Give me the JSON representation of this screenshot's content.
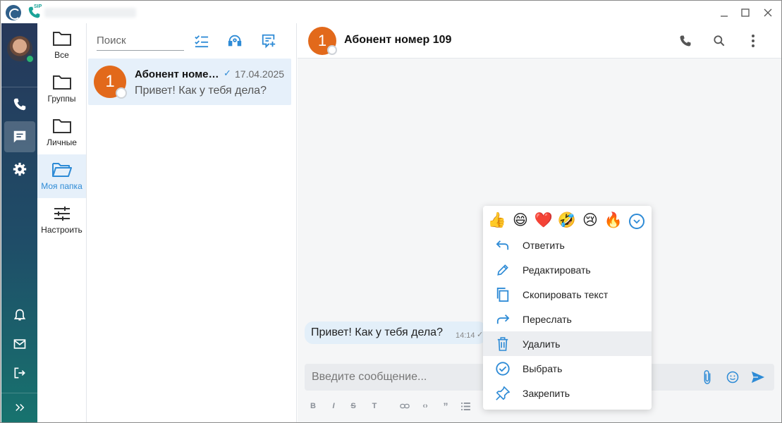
{
  "colors": {
    "accent": "#2e8bd6",
    "avatar_orange": "#e2691b",
    "online_green": "#2bb673"
  },
  "sidebar": {
    "items": [
      {
        "icon": "phone-icon"
      },
      {
        "icon": "chat-icon",
        "active": true
      },
      {
        "icon": "gear-icon"
      },
      {
        "icon": "bell-icon"
      },
      {
        "icon": "mail-icon"
      },
      {
        "icon": "logout-icon"
      },
      {
        "icon": "expand-icon"
      }
    ]
  },
  "folders": [
    {
      "label": "Все",
      "icon": "folder-icon"
    },
    {
      "label": "Группы",
      "icon": "folder-icon"
    },
    {
      "label": "Личные",
      "icon": "folder-icon"
    },
    {
      "label": "Моя папка",
      "icon": "folder-open-icon",
      "active": true
    },
    {
      "label": "Настроить",
      "icon": "sliders-icon"
    }
  ],
  "search": {
    "placeholder": "Поиск"
  },
  "chat_list": [
    {
      "avatar_text": "1",
      "name": "Абонент номер 109",
      "date": "17.04.2025",
      "preview": "Привет! Как у тебя дела?"
    }
  ],
  "conversation": {
    "avatar_text": "1",
    "title": "Абонент номер 109",
    "message": {
      "text": "Привет! Как у тебя дела?",
      "time": "14:14"
    },
    "composer_placeholder": "Введите сообщение..."
  },
  "context_menu": {
    "reactions": [
      "👍",
      "😄",
      "❤️",
      "🤣",
      "😢",
      "🔥"
    ],
    "items": [
      {
        "label": "Ответить",
        "icon": "reply-icon"
      },
      {
        "label": "Редактировать",
        "icon": "pencil-icon"
      },
      {
        "label": "Скопировать текст",
        "icon": "copy-icon"
      },
      {
        "label": "Переслать",
        "icon": "forward-icon"
      },
      {
        "label": "Удалить",
        "icon": "trash-icon",
        "highlighted": true
      },
      {
        "label": "Выбрать",
        "icon": "check-circle-icon"
      },
      {
        "label": "Закрепить",
        "icon": "pin-icon"
      }
    ]
  }
}
